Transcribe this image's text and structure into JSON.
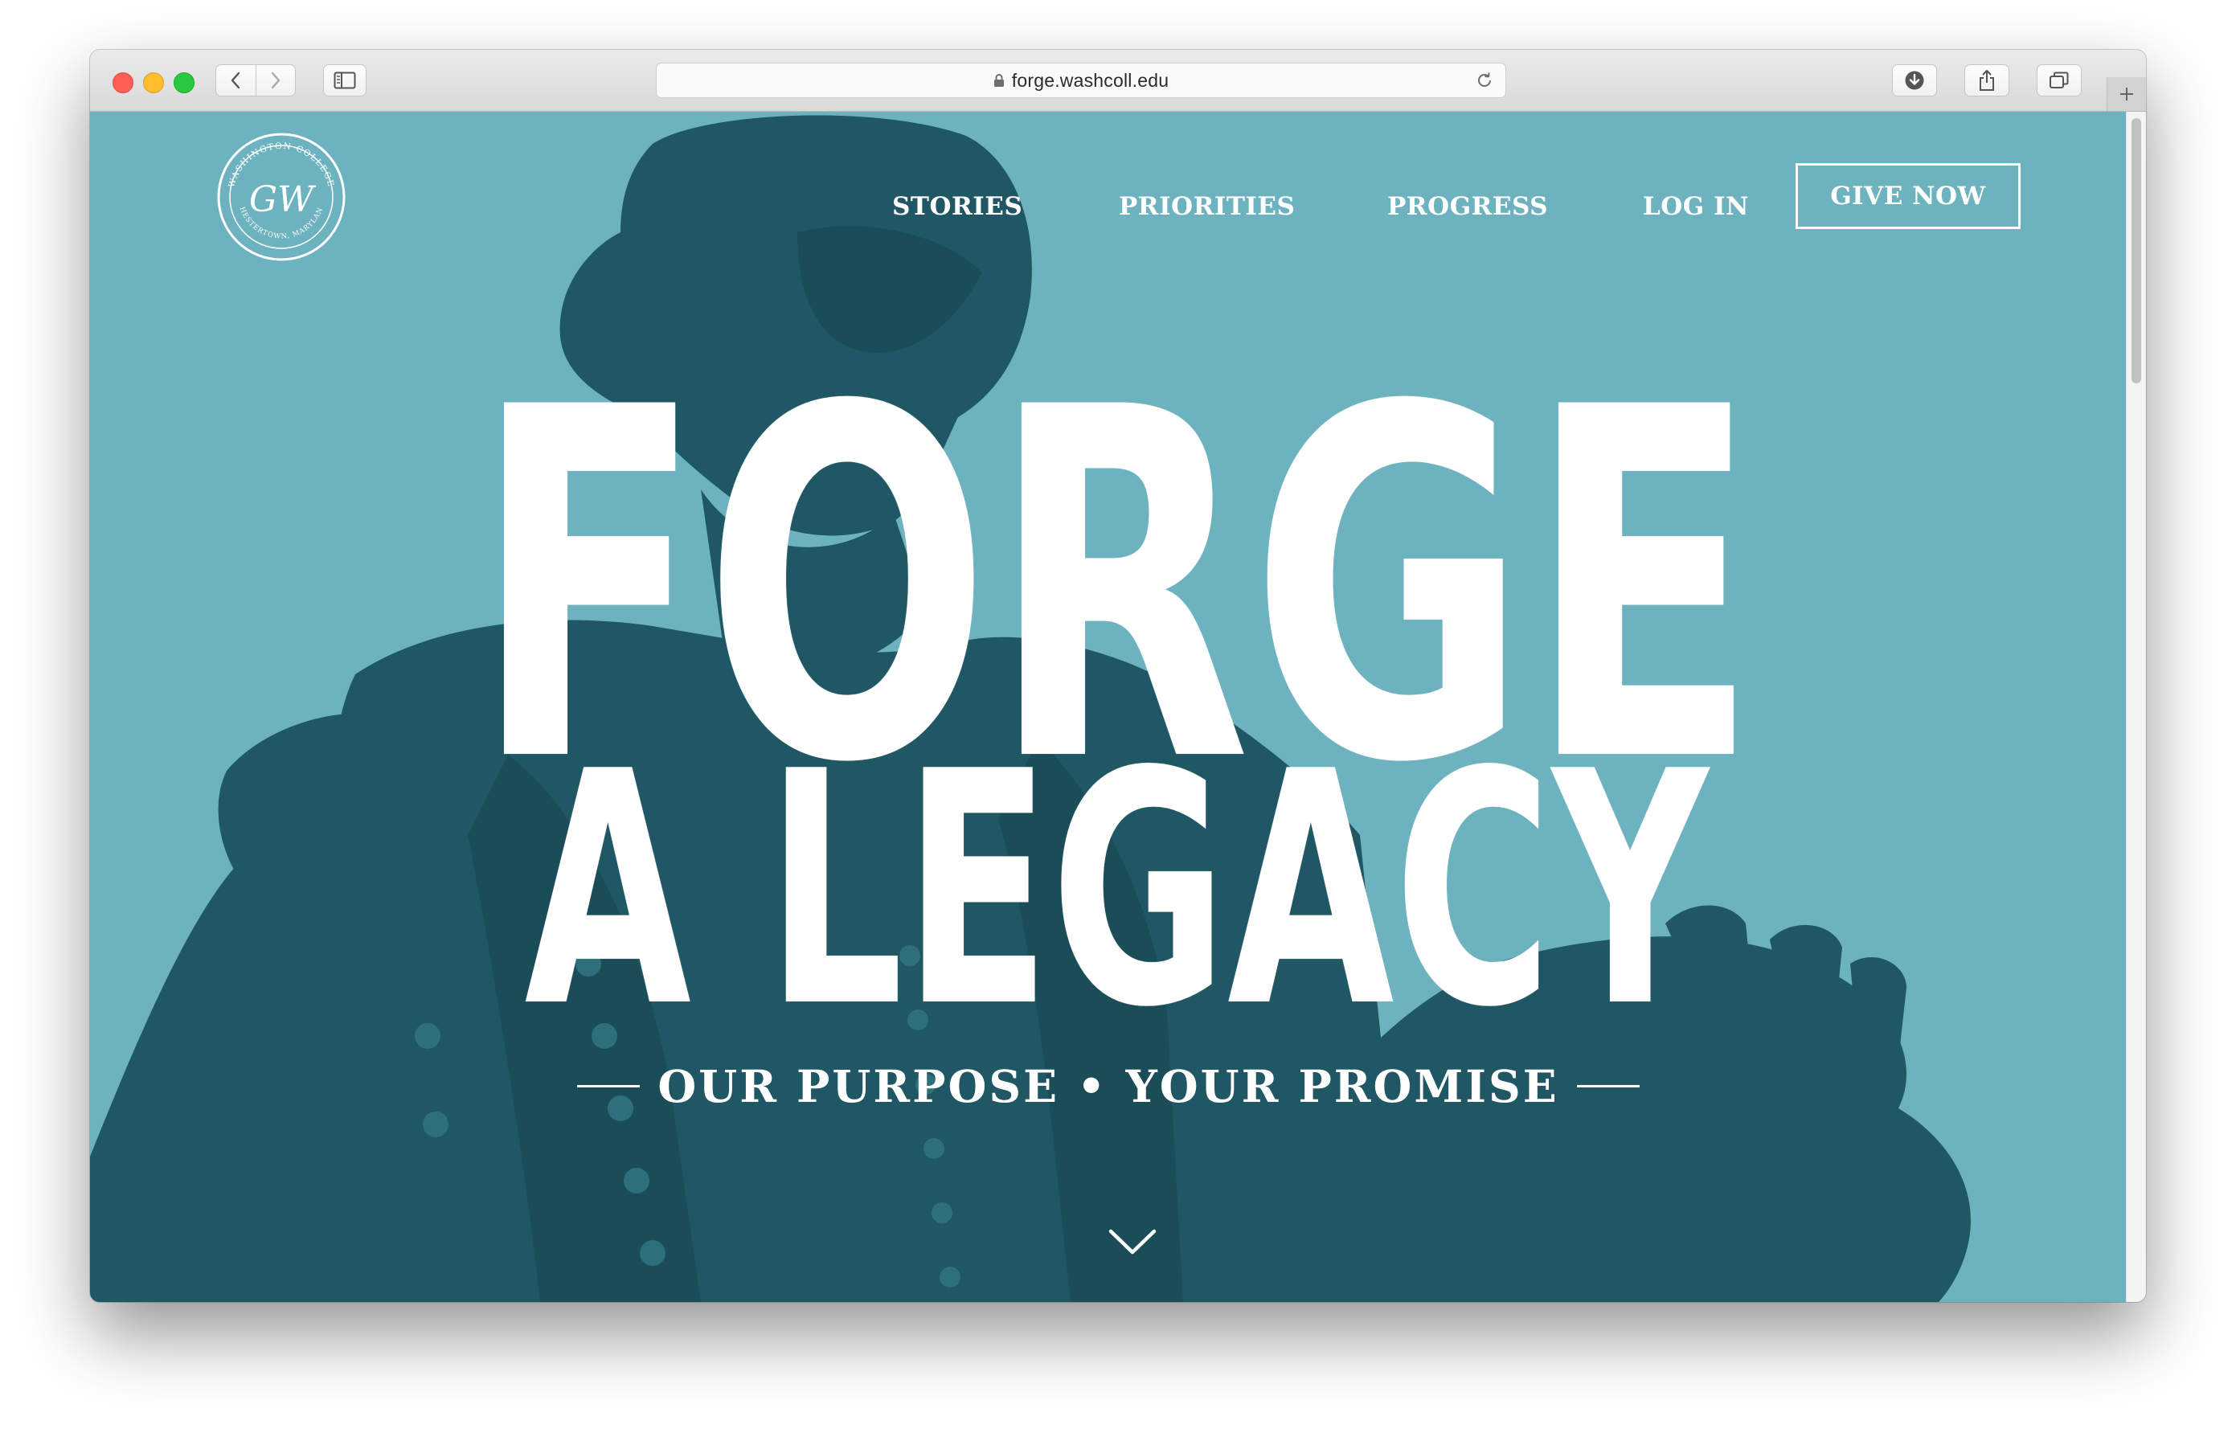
{
  "browser": {
    "url": "forge.washcoll.edu",
    "lock_icon": "lock-icon",
    "reload_icon": "reload-icon"
  },
  "site": {
    "logo": {
      "ring_text_top": "WASHINGTON COLLEGE",
      "ring_text_bottom": "CHESTERTOWN, MARYLAND",
      "monogram": "GW"
    },
    "nav": {
      "stories": "STORIES",
      "priorities": "PRIORITIES",
      "progress": "PROGRESS",
      "login": "LOG IN",
      "give_now": "GIVE NOW"
    },
    "hero": {
      "line1": "FORGE",
      "line2": "A LEGACY",
      "tagline": "OUR PURPOSE • YOUR PROMISE",
      "scroll_icon": "chevron-down-icon"
    }
  },
  "colors": {
    "hero_background": "#6db3bf",
    "statue_shade": "#1f5864",
    "text": "#ffffff"
  }
}
